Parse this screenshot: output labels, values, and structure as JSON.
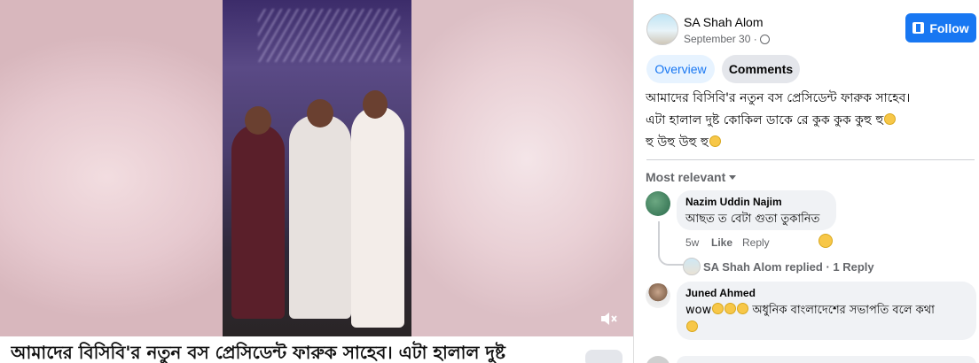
{
  "video": {
    "caption": "আমাদের বিসিবি'র নতুন বস প্রেসিডেন্ট ফারুক সাহেব। এটা হালাল দুষ্ট"
  },
  "post": {
    "author": "SA Shah Alom",
    "date": "September 30 ·",
    "follow_label": "Follow",
    "tabs": [
      {
        "label": "Overview"
      },
      {
        "label": "Comments"
      }
    ],
    "text_lines": [
      "আমাদের বিসিবি'র নতুন বস প্রেসিডেন্ট ফারুক সাহেব।",
      "এটা হালাল দুষ্ট কোকিল ডাকে রে কুক কুক কুহু হু",
      "হু উহু উহু হু"
    ]
  },
  "comments": {
    "sort_label": "Most relevant",
    "items": [
      {
        "author": "Nazim Uddin Najim",
        "text": "আছত ত বেটা গুতা তুকানিত",
        "time": "5w",
        "like": "Like",
        "reply": "Reply",
        "replies_summary": "SA Shah Alom replied · 1 Reply"
      },
      {
        "author": "Juned Ahmed",
        "text_prefix": "wow",
        "text": "অধুনিক বাংলাদেশের সভাপতি বলে কথা"
      }
    ]
  },
  "colors": {
    "accent": "#1877f2",
    "tab_active_bg": "#e7f3ff",
    "bubble_bg": "#f0f2f5",
    "muted_text": "#65676b"
  }
}
